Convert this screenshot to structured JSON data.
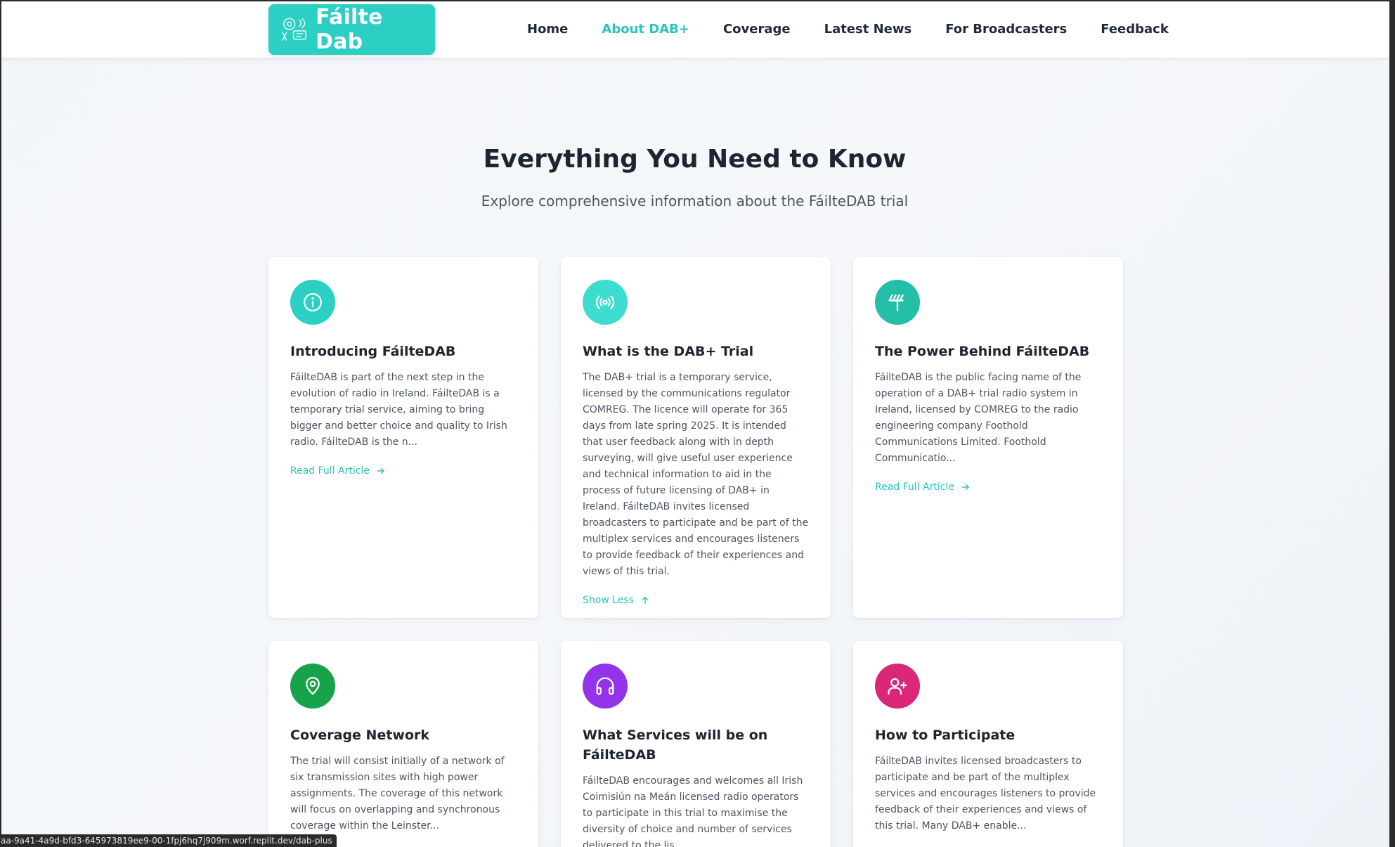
{
  "header": {
    "logo_text": "Fáilte Dab",
    "nav": [
      {
        "label": "Home",
        "active": false
      },
      {
        "label": "About DAB+",
        "active": true
      },
      {
        "label": "Coverage",
        "active": false
      },
      {
        "label": "Latest News",
        "active": false
      },
      {
        "label": "For Broadcasters",
        "active": false
      },
      {
        "label": "Feedback",
        "active": false
      }
    ]
  },
  "hero": {
    "title": "Everything You Need to Know",
    "subtitle": "Explore comprehensive information about the FáilteDAB trial"
  },
  "cards": [
    {
      "icon": "info-icon",
      "color": "#2ccfc3",
      "title": "Introducing FáilteDAB",
      "body": "FáilteDAB is part of the next step in the evolution of radio in Ireland. FáilteDAB is a temporary trial service, aiming to bring bigger and better choice and quality to Irish radio. FáilteDAB is the n...",
      "link": "Read Full Article"
    },
    {
      "icon": "broadcast-icon",
      "color": "#3ddccf",
      "title": "What is the DAB+ Trial",
      "body": "The DAB+ trial is a temporary service, licensed by the communications regulator COMREG. The licence will operate for 365 days from late spring 2025. It is intended that user feedback along with in depth surveying, will give useful user experience and technical information to aid in the process of future licensing of DAB+ in Ireland. FáilteDAB invites licensed broadcasters to participate and be part of the multiplex services and encourages listeners to provide feedback of their experiences and views of this trial.",
      "link": "Show Less"
    },
    {
      "icon": "antenna-icon",
      "color": "#22bfa6",
      "title": "The Power Behind FáilteDAB",
      "body": "FáilteDAB is the public facing name of the operation of a DAB+ trial radio system in Ireland, licensed by COMREG to the radio engineering company Foothold Communications Limited. Foothold Communicatio...",
      "link": "Read Full Article"
    },
    {
      "icon": "map-pin-icon",
      "color": "#16a34a",
      "title": "Coverage Network",
      "body": "The trial will consist initially of a network of six transmission sites with high power assignments. The coverage of this network will focus on overlapping and synchronous coverage within the Leinster..."
    },
    {
      "icon": "headphones-icon",
      "color": "#9333ea",
      "title": "What Services will be on FáilteDAB",
      "body": "FáilteDAB encourages and welcomes all Irish Coimisiún na Meán licensed radio operators to participate in this trial to maximise the diversity of choice and number of services delivered to the lis..."
    },
    {
      "icon": "user-plus-icon",
      "color": "#db2777",
      "title": "How to Participate",
      "body": "FáilteDAB invites licensed broadcasters to participate and be part of the multiplex services and encourages listeners to provide feedback of their experiences and views of this trial. Many DAB+ enable..."
    }
  ],
  "status_bar": {
    "url": "aa-9a41-4a9d-bfd3-645973819ee9-00-1fpj6hq7j909m.worf.replit.dev/dab-plus"
  }
}
